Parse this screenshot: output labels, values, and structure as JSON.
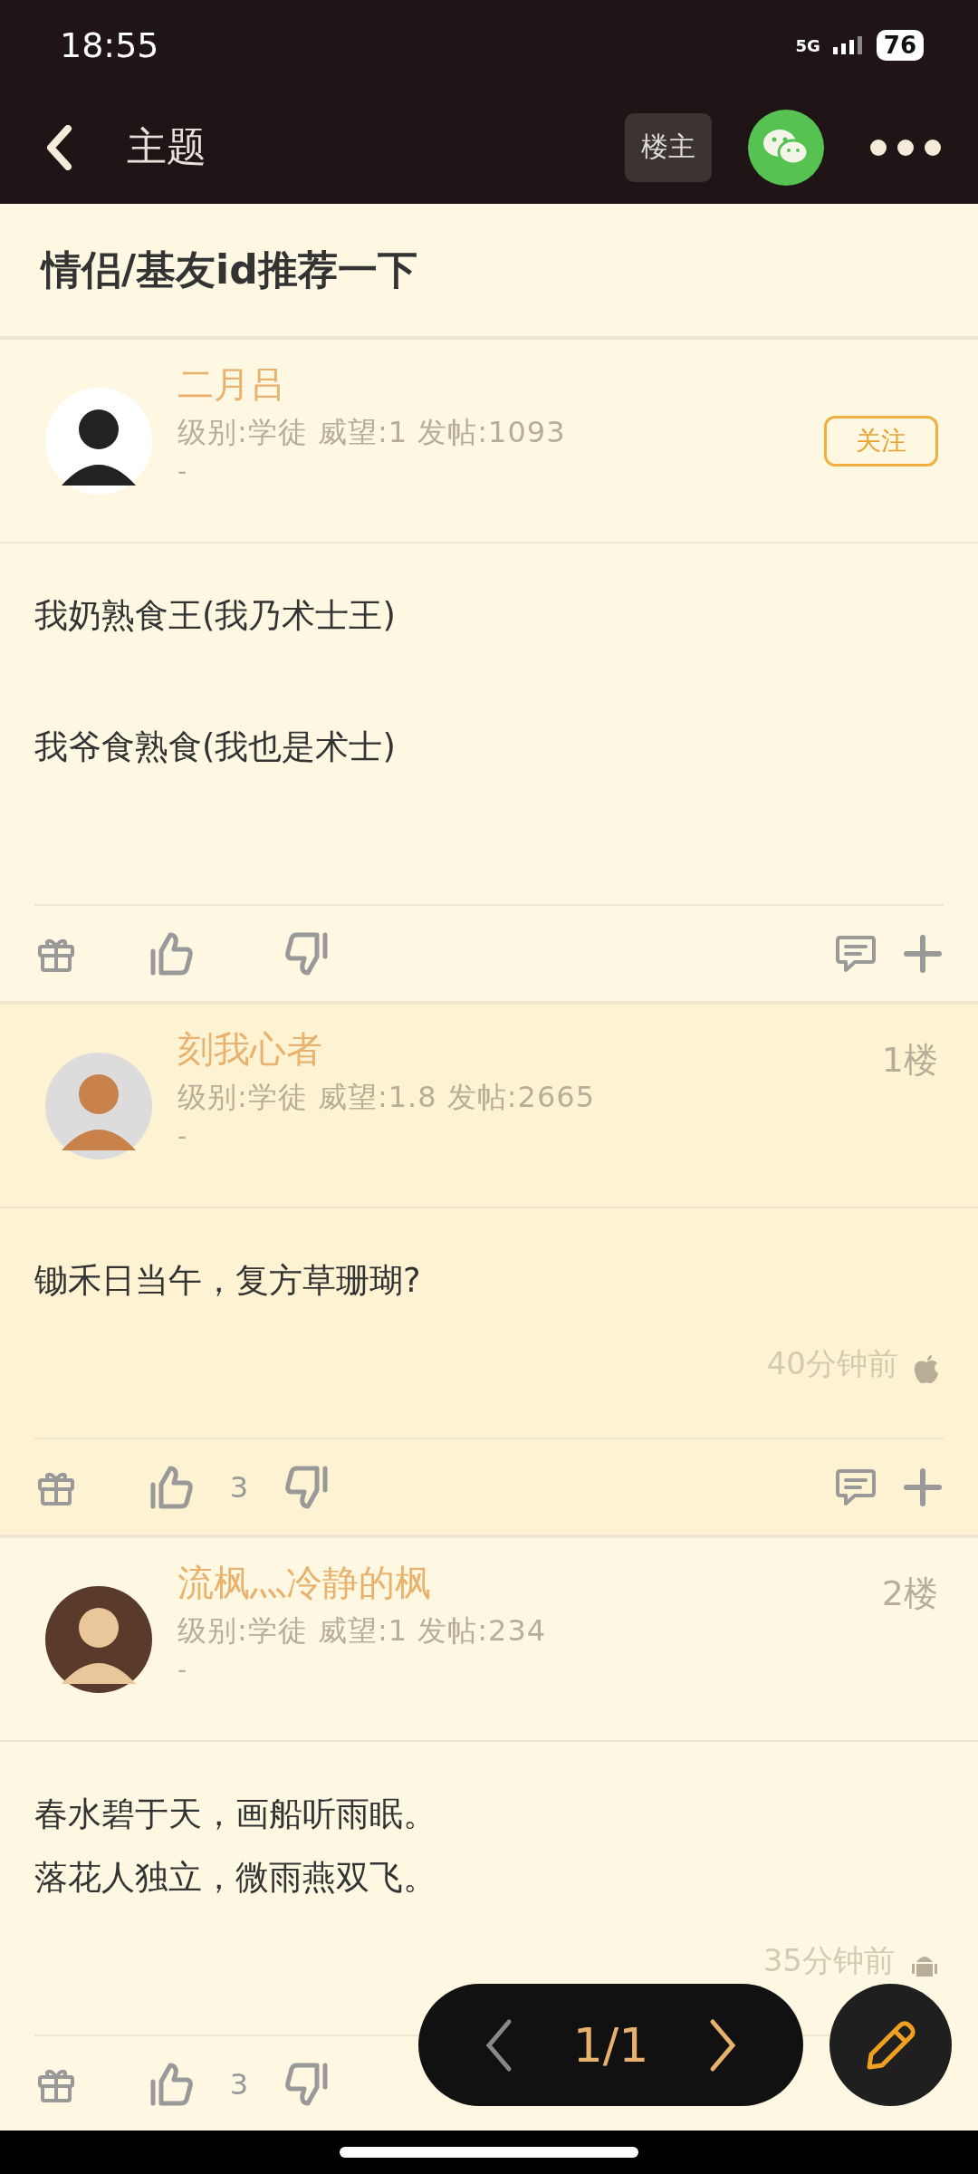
{
  "status_bar": {
    "time": "18:55",
    "network": "5G",
    "battery": "76"
  },
  "nav": {
    "title": "主题",
    "author_button": "楼主"
  },
  "thread_title": "情侣/基友id推荐一下",
  "posts": [
    {
      "author": "二月吕",
      "meta": "级别:学徒 威望:1 发帖:1093",
      "signature": "-",
      "follow_button": "关注",
      "highlighted": false,
      "paragraphs": [
        [
          "我奶熟食王(我乃术士王)"
        ],
        [
          "我爷食熟食(我也是术士)"
        ]
      ]
    },
    {
      "author": "刻我心者",
      "meta": "级别:学徒 威望:1.8 发帖:2665",
      "signature": "-",
      "floor": "1楼",
      "highlighted": true,
      "paragraphs": [
        [
          "锄禾日当午，复方草珊瑚?"
        ]
      ],
      "time": "40分钟前",
      "device": {
        "kind": "apple"
      },
      "likes": "3"
    },
    {
      "author": "流枫灬冷静的枫",
      "meta": "级别:学徒 威望:1 发帖:234",
      "signature": "-",
      "floor": "2楼",
      "highlighted": false,
      "paragraphs": [
        [
          "春水碧于天，画船听雨眠。",
          "落花人独立，微雨燕双飞。"
        ]
      ],
      "time": "35分钟前",
      "device": {
        "kind": "android"
      },
      "likes": "3"
    }
  ],
  "pager": {
    "label": "1/1"
  }
}
